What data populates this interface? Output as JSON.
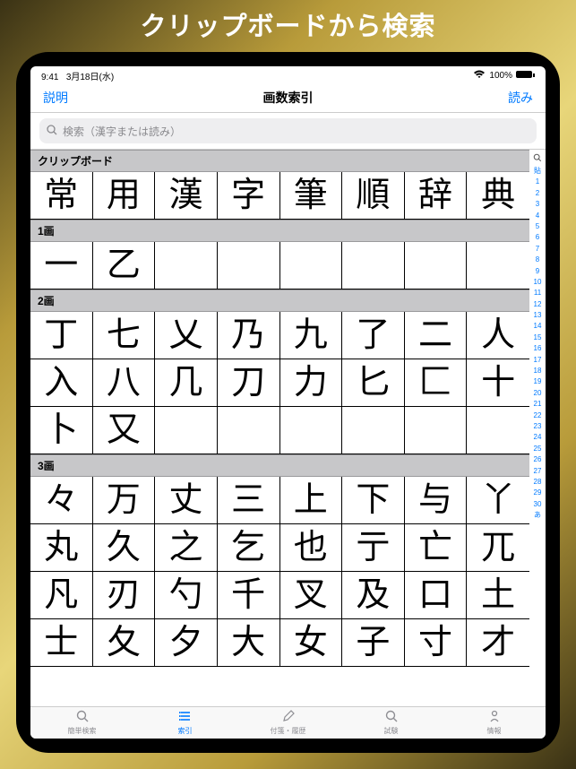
{
  "banner": "クリップボードから検索",
  "status": {
    "time": "9:41",
    "date": "3月18日(水)",
    "signal_pct": "100%"
  },
  "nav": {
    "left": "説明",
    "title": "画数索引",
    "right": "読み"
  },
  "search": {
    "placeholder": "検索（漢字または読み）"
  },
  "sections": [
    {
      "header": "クリップボード",
      "cells": [
        "常",
        "用",
        "漢",
        "字",
        "筆",
        "順",
        "辞",
        "典"
      ]
    },
    {
      "header": "1画",
      "cells": [
        "一",
        "乙",
        "",
        "",
        "",
        "",
        "",
        ""
      ]
    },
    {
      "header": "2画",
      "cells": [
        "丁",
        "七",
        "乂",
        "乃",
        "九",
        "了",
        "二",
        "人",
        "入",
        "八",
        "几",
        "刀",
        "力",
        "匕",
        "匚",
        "十",
        "卜",
        "又",
        "",
        "",
        "",
        "",
        "",
        ""
      ]
    },
    {
      "header": "3画",
      "cells": [
        "々",
        "万",
        "丈",
        "三",
        "上",
        "下",
        "与",
        "丫",
        "丸",
        "久",
        "之",
        "乞",
        "也",
        "亍",
        "亡",
        "兀",
        "凡",
        "刃",
        "勺",
        "千",
        "叉",
        "及",
        "口",
        "土",
        "士",
        "夂",
        "夕",
        "大",
        "女",
        "子",
        "寸",
        "才"
      ]
    }
  ],
  "index_rail": [
    "貼",
    "1",
    "2",
    "3",
    "4",
    "5",
    "6",
    "7",
    "8",
    "9",
    "10",
    "11",
    "12",
    "13",
    "14",
    "15",
    "16",
    "17",
    "18",
    "19",
    "20",
    "21",
    "22",
    "23",
    "24",
    "25",
    "26",
    "27",
    "28",
    "29",
    "30",
    "あ"
  ],
  "tabs": [
    {
      "label": "簡単検索"
    },
    {
      "label": "索引",
      "active": true
    },
    {
      "label": "付箋・履歴"
    },
    {
      "label": "試験"
    },
    {
      "label": "情報"
    }
  ]
}
